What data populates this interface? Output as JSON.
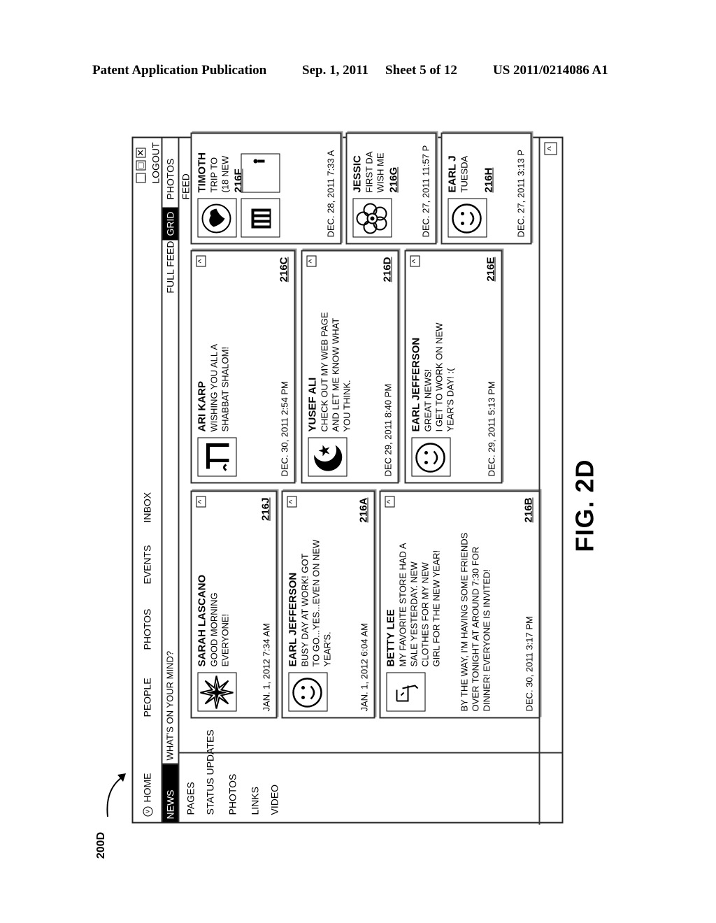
{
  "header": {
    "publication": "Patent Application Publication",
    "date": "Sep. 1, 2011",
    "sheet": "Sheet 5 of 12",
    "number": "US 2011/0214086 A1"
  },
  "reference_label": "200D",
  "figure_label": "FIG. 2D",
  "window": {
    "top_nav": [
      "HOME",
      "PEOPLE",
      "PHOTOS",
      "EVENTS",
      "INBOX"
    ],
    "logout": "LOGOUT",
    "window_controls": [
      "minimize",
      "restore",
      "close"
    ],
    "news_feed": "NEWS FEED",
    "search_placeholder": "WHAT'S ON YOUR MIND?",
    "view_tabs": [
      {
        "label": "FULL FEED",
        "active": false
      },
      {
        "label": "GRID",
        "active": true
      },
      {
        "label": "PHOTOS FEED",
        "active": false
      }
    ],
    "sidebar": [
      "PAGES",
      "STATUS UPDATES",
      "PHOTOS",
      "LINKS",
      "VIDEO"
    ],
    "scroll_button": "^",
    "cards": [
      {
        "id": "216J",
        "name": "SARAH LASCANO",
        "text": "GOOD MORNING\nEVERYONE!",
        "time": "JAN. 1, 2012 7:34 AM",
        "avatar": "star-icon"
      },
      {
        "id": "216A",
        "name": "EARL JEFFERSON",
        "text": "BUSY DAY AT WORK!  GOT\nTO GO...YES...EVEN ON NEW\nYEAR'S.",
        "time": "JAN. 1, 2012 6:04 AM",
        "avatar": "smiley-icon"
      },
      {
        "id": "216B",
        "name": "BETTY LEE",
        "text": "MY FAVORITE STORE HAD A\nSALE YESTERDAY.  NEW\nCLOTHES FOR MY NEW\nGIRL FOR THE NEW YEAR!",
        "text2": "BY THE WAY, I'M HAVING SOME FRIENDS\nOVER TONIGHT AT AROUND 7:30 FOR\nDINNER!  EVERYONE IS INVITED!",
        "time": "DEC. 30, 2011 3:17 PM",
        "avatar": "chinese-character-icon"
      },
      {
        "id": "216C",
        "name": "ARI KARP",
        "text": "WISHING YOU ALL A\nSHABBAT SHALOM!",
        "time": "DEC. 30, 2011 2:54 PM",
        "avatar": "hebrew-letters-icon"
      },
      {
        "id": "216D",
        "name": "YUSEF ALI",
        "text": "CHECK OUT MY WEB PAGE\nAND LET ME KNOW WHAT\nYOU THINK.",
        "time": "DEC 29, 2011 8:40 PM",
        "avatar": "crescent-star-icon"
      },
      {
        "id": "216E",
        "name": "EARL JEFFERSON",
        "text": "GREAT NEWS!\nI GET TO WORK ON NEW\nYEAR'S DAY! :(",
        "time": "DEC. 29, 2011 5:13 PM",
        "avatar": "smiley-icon"
      },
      {
        "id": "216F",
        "name": "TIMOTH",
        "text": "TRIP TO\n(18 NEW",
        "time": "DEC. 28, 2011 7:33 A",
        "avatar": "globe-icon"
      },
      {
        "id": "216G",
        "name": "JESSIC",
        "text": "FIRST DA\nWISH ME",
        "time": "DEC. 27, 2011 11:57 P",
        "avatar": "flower-icon"
      },
      {
        "id": "216H",
        "name": "EARL J",
        "text": "TUESDA",
        "time": "DEC. 27, 2011 3:13 P",
        "avatar": "smiley-icon"
      }
    ]
  }
}
